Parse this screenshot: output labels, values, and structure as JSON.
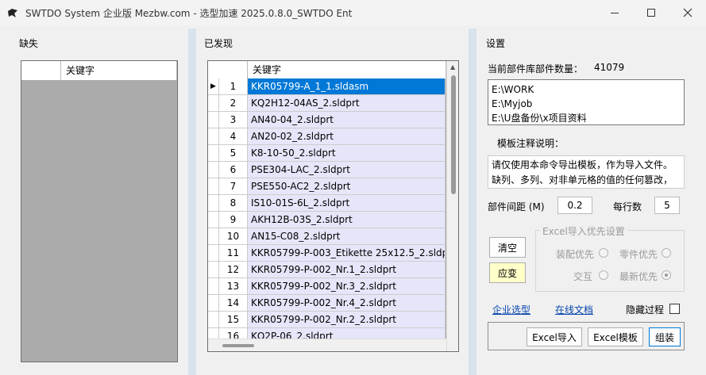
{
  "window": {
    "title": "SWTDO System 企业版 Mezbw.com - 选型加速  2025.0.8.0_SWTDO Ent",
    "min_label": "—",
    "max_label": "☐",
    "close_label": "✕"
  },
  "missing": {
    "group_label": "缺失",
    "column_header": "关键字"
  },
  "found": {
    "group_label": "已发现",
    "column_header": "关键字",
    "selected_marker": "▶",
    "rows": [
      {
        "num": "1",
        "keyword": "KKR05799-A_1_1.sldasm"
      },
      {
        "num": "2",
        "keyword": "KQ2H12-04AS_2.sldprt"
      },
      {
        "num": "3",
        "keyword": "AN40-04_2.sldprt"
      },
      {
        "num": "4",
        "keyword": "AN20-02_2.sldprt"
      },
      {
        "num": "5",
        "keyword": "K8-10-50_2.sldprt"
      },
      {
        "num": "6",
        "keyword": "PSE304-LAC_2.sldprt"
      },
      {
        "num": "7",
        "keyword": "PSE550-AC2_2.sldprt"
      },
      {
        "num": "8",
        "keyword": "IS10-01S-6L_2.sldprt"
      },
      {
        "num": "9",
        "keyword": "AKH12B-03S_2.sldprt"
      },
      {
        "num": "10",
        "keyword": "AN15-C08_2.sldprt"
      },
      {
        "num": "11",
        "keyword": "KKR05799-P-003_Etikette 25x12.5_2.sldprt"
      },
      {
        "num": "12",
        "keyword": "KKR05799-P-002_Nr.1_2.sldprt"
      },
      {
        "num": "13",
        "keyword": "KKR05799-P-002_Nr.3_2.sldprt"
      },
      {
        "num": "14",
        "keyword": "KKR05799-P-002_Nr.4_2.sldprt"
      },
      {
        "num": "15",
        "keyword": "KKR05799-P-002_Nr.2_2.sldprt"
      },
      {
        "num": "16",
        "keyword": "KQ2P-06_2.sldprt"
      }
    ]
  },
  "settings": {
    "group_label": "设置",
    "part_count_label": "当前部件库部件数量：",
    "part_count_value": "41079",
    "library_paths": [
      "E:\\WORK",
      "E:\\Myjob",
      "E:\\U盘备份\\x项目资料"
    ],
    "template_note_label": "模板注释说明：",
    "template_note_lines": [
      "请仅使用本命令导出模板，作为导入文件。",
      "缺列、多列、对非单元格的值的任何篡改，"
    ],
    "spacing_label": "部件间距 (M)",
    "spacing_value": "0.2",
    "per_row_label": "每行数",
    "per_row_value": "5",
    "clear_button": "清空",
    "apply_button": "应变",
    "excel_priority_legend": "Excel导入优先设置",
    "radio_assembly": "装配优先",
    "radio_part": "零件优先",
    "radio_intersect": "交互",
    "radio_latest": "最新优先",
    "link_enterprise": "企业选型",
    "link_docs": "在线文档",
    "hide_process_label": "隐藏过程",
    "excel_import_button": "Excel导入",
    "excel_template_button": "Excel模板",
    "assemble_button": "组装"
  }
}
